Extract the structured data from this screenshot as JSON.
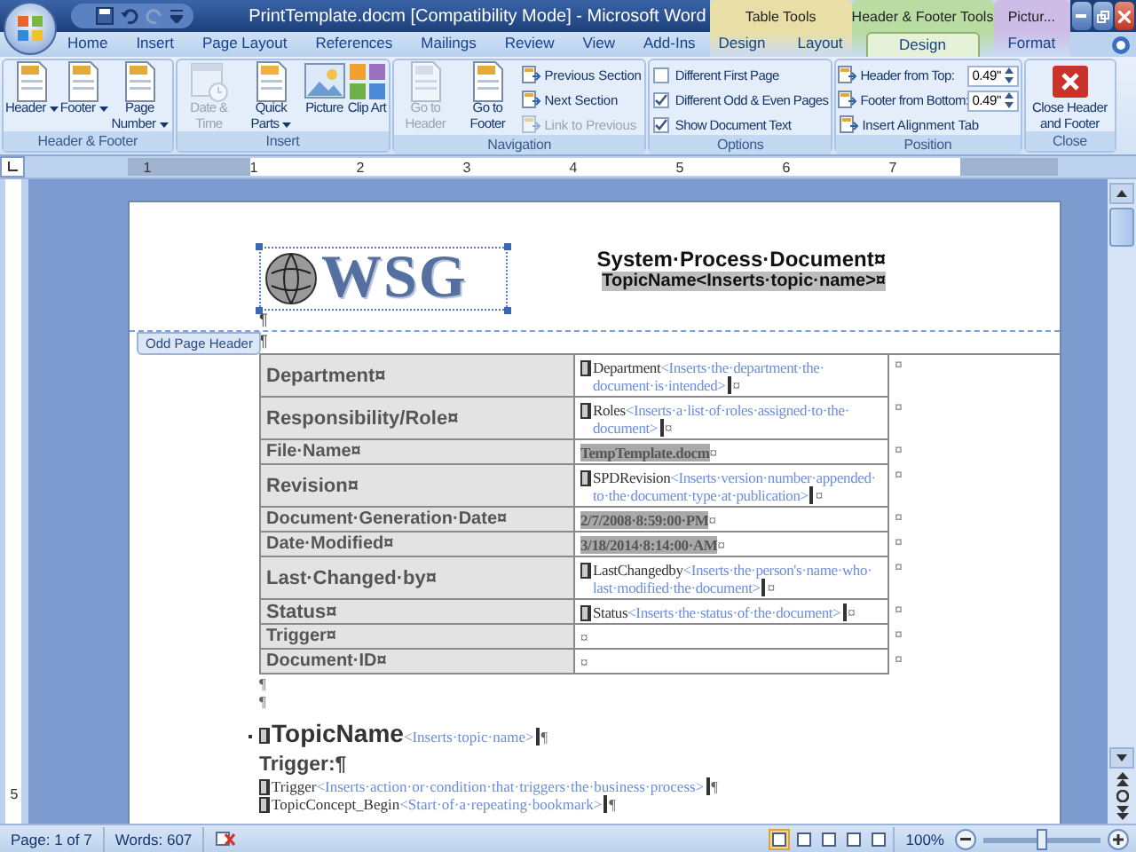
{
  "window": {
    "title": "PrintTemplate.docm [Compatibility Mode] - Microsoft Word"
  },
  "tabs": [
    {
      "label": "Home",
      "selected": false
    },
    {
      "label": "Insert",
      "selected": false
    },
    {
      "label": "Page Layout",
      "selected": false
    },
    {
      "label": "References",
      "selected": false
    },
    {
      "label": "Mailings",
      "selected": false
    },
    {
      "label": "Review",
      "selected": false
    },
    {
      "label": "View",
      "selected": false
    },
    {
      "label": "Add-Ins",
      "selected": false
    }
  ],
  "context_groups": [
    {
      "label": "Table Tools",
      "color": "#e9dfa6",
      "tabs": [
        {
          "label": "Design",
          "selected": false
        },
        {
          "label": "Layout",
          "selected": false
        }
      ]
    },
    {
      "label": "Header & Footer Tools",
      "color": "#b9dca3",
      "tabs": [
        {
          "label": "Design",
          "selected": true
        }
      ]
    },
    {
      "label": "Pictur...",
      "color": "#cdbde6",
      "tabs": [
        {
          "label": "Format",
          "selected": false
        }
      ]
    }
  ],
  "ribbon": [
    {
      "label": "Header & Footer",
      "items": [
        {
          "kind": "large",
          "label": "Header",
          "menu": true,
          "disabled": false
        },
        {
          "kind": "large",
          "label": "Footer",
          "menu": true,
          "disabled": false
        },
        {
          "kind": "large",
          "label": "Page Number",
          "menu": true,
          "disabled": false
        }
      ]
    },
    {
      "label": "Insert",
      "items": [
        {
          "kind": "large",
          "label": "Date & Time",
          "menu": false,
          "disabled": true
        },
        {
          "kind": "large",
          "label": "Quick Parts",
          "menu": true,
          "disabled": false
        },
        {
          "kind": "large",
          "label": "Picture",
          "menu": false,
          "disabled": false
        },
        {
          "kind": "large",
          "label": "Clip Art",
          "menu": false,
          "disabled": false
        }
      ]
    },
    {
      "label": "Navigation",
      "items": [
        {
          "kind": "large",
          "label": "Go to Header",
          "menu": false,
          "disabled": true
        },
        {
          "kind": "large",
          "label": "Go to Footer",
          "menu": false,
          "disabled": false
        },
        {
          "kind": "small",
          "label": "Previous Section",
          "disabled": false
        },
        {
          "kind": "small",
          "label": "Next Section",
          "disabled": false
        },
        {
          "kind": "small",
          "label": "Link to Previous",
          "disabled": true
        }
      ]
    },
    {
      "label": "Options",
      "items": [
        {
          "kind": "check",
          "label": "Different First Page",
          "checked": false
        },
        {
          "kind": "check",
          "label": "Different Odd & Even Pages",
          "checked": true
        },
        {
          "kind": "check",
          "label": "Show Document Text",
          "checked": true
        }
      ]
    },
    {
      "label": "Position",
      "items": [
        {
          "kind": "spin",
          "label": "Header from Top:",
          "value": "0.49\""
        },
        {
          "kind": "spin",
          "label": "Footer from Bottom:",
          "value": "0.49\""
        },
        {
          "kind": "small",
          "label": "Insert Alignment Tab",
          "disabled": false
        }
      ]
    },
    {
      "label": "Close",
      "items": [
        {
          "kind": "large",
          "label": "Close Header and Footer",
          "menu": false,
          "disabled": false
        }
      ]
    }
  ],
  "ruler": {
    "labels": [
      "1",
      "1",
      "2",
      "3",
      "4",
      "5",
      "6",
      "7"
    ]
  },
  "vertical_ruler": {
    "labels": [
      "5"
    ]
  },
  "document": {
    "header": {
      "logo": "WSG",
      "title": "System·Process·Document¤",
      "topic": "TopicName<Inserts·topic·name>¤",
      "marks": [
        "¶",
        "¶"
      ],
      "region_label": "Odd Page Header"
    },
    "table": {
      "rows": [
        {
          "label": "Department¤",
          "value": {
            "kind": "field",
            "name": "Department",
            "hint": "<Inserts·the·department·the·document·is·intended>",
            "mark": "¤"
          },
          "row_mark": "¤"
        },
        {
          "label": "Responsibility/Role¤",
          "value": {
            "kind": "field",
            "name": "Roles",
            "hint": "<Inserts·a·list·of·roles·assigned·to·the·document>",
            "mark": "¤"
          },
          "row_mark": "¤"
        },
        {
          "label": "File·Name¤",
          "value": {
            "kind": "plain",
            "text": "TempTemplate.docm",
            "mark": "¤"
          },
          "row_mark": "¤"
        },
        {
          "label": "Revision¤",
          "value": {
            "kind": "field",
            "name": "SPDRevision",
            "hint": "<Inserts·version·number·appended·to·the·document·type·at·publication>",
            "mark": "¤"
          },
          "row_mark": "¤"
        },
        {
          "label": "Document·Generation·Date¤",
          "value": {
            "kind": "plain",
            "text": "2/7/2008·8:59:00·PM",
            "mark": "¤"
          },
          "row_mark": "¤"
        },
        {
          "label": "Date·Modified¤",
          "value": {
            "kind": "plain",
            "text": "3/18/2014·8:14:00·AM",
            "mark": "¤"
          },
          "row_mark": "¤"
        },
        {
          "label": "Last·Changed·by¤",
          "value": {
            "kind": "field",
            "name": "LastChangedby",
            "hint": "<Inserts·the·person's·name·who·last·modified·the·document>",
            "mark": "¤"
          },
          "row_mark": "¤"
        },
        {
          "label": "Status¤",
          "value": {
            "kind": "field",
            "name": "Status",
            "hint": "<Inserts·the·status·of·the·document>",
            "mark": "¤"
          },
          "row_mark": "¤"
        },
        {
          "label": "Trigger¤",
          "value": {
            "kind": "empty",
            "mark": "¤"
          },
          "row_mark": "¤"
        },
        {
          "label": "Document·ID¤",
          "value": {
            "kind": "empty",
            "mark": "¤"
          },
          "row_mark": "¤"
        }
      ]
    },
    "body": [
      {
        "kind": "mark",
        "text": "¶"
      },
      {
        "kind": "mark",
        "text": "¶"
      },
      {
        "kind": "heading",
        "name": "TopicName",
        "hint": "<Inserts·topic·name>",
        "mark": "¶"
      },
      {
        "kind": "subheading",
        "text": "Trigger:¶"
      },
      {
        "kind": "field",
        "name": "Trigger",
        "hint": "<Inserts·action·or·condition·that·triggers·the·business·process>",
        "mark": "¶"
      },
      {
        "kind": "field",
        "name": "TopicConcept_Begin",
        "hint": "<Start·of·a·repeating·bookmark>",
        "mark": "¶"
      }
    ]
  },
  "status_bar": {
    "page": "Page: 1 of 7",
    "words": "Words: 607",
    "zoom": "100%",
    "zoom_slider": {
      "level": 0.5
    }
  }
}
